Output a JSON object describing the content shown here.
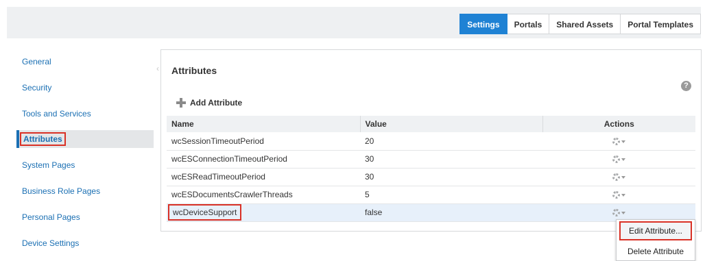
{
  "tabs": [
    {
      "label": "Settings",
      "active": true
    },
    {
      "label": "Portals",
      "active": false
    },
    {
      "label": "Shared Assets",
      "active": false
    },
    {
      "label": "Portal Templates",
      "active": false
    }
  ],
  "sidebar": {
    "items": [
      {
        "label": "General"
      },
      {
        "label": "Security"
      },
      {
        "label": "Tools and Services"
      },
      {
        "label": "Attributes",
        "active": true
      },
      {
        "label": "System Pages"
      },
      {
        "label": "Business Role Pages"
      },
      {
        "label": "Personal Pages"
      },
      {
        "label": "Device Settings"
      }
    ]
  },
  "panel": {
    "title": "Attributes",
    "help_icon_glyph": "?",
    "add_label": "Add Attribute"
  },
  "table": {
    "columns": [
      "Name",
      "Value",
      "Actions"
    ],
    "rows": [
      {
        "name": "wcSessionTimeoutPeriod",
        "value": "20"
      },
      {
        "name": "wcESConnectionTimeoutPeriod",
        "value": "30"
      },
      {
        "name": "wcESReadTimeoutPeriod",
        "value": "30"
      },
      {
        "name": "wcESDocumentsCrawlerThreads",
        "value": "5"
      },
      {
        "name": "wcDeviceSupport",
        "value": "false",
        "selected": true
      }
    ]
  },
  "context_menu": {
    "items": [
      {
        "label": "Edit Attribute..."
      },
      {
        "label": "Delete Attribute"
      }
    ]
  },
  "colors": {
    "accent": "#1f82d4",
    "link": "#1a6fb3",
    "highlight_box": "#d93025"
  }
}
